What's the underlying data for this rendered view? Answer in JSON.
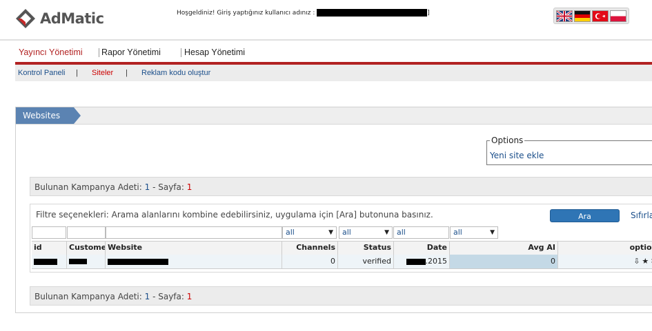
{
  "header": {
    "logo_text": "AdMatic",
    "welcome_text": "Hoşgeldiniz! Giriş yaptığınız kullanıcı adınız :",
    "welcome_suffix": "]",
    "flags": [
      "uk-flag-icon",
      "germany-flag-icon",
      "turkey-flag-icon",
      "poland-flag-icon"
    ]
  },
  "main_nav": {
    "items": [
      {
        "label": "Yayıncı Yönetimi",
        "active": true
      },
      {
        "label": "Rapor Yönetimi",
        "active": false
      },
      {
        "label": "Hesap Yönetimi",
        "active": false
      }
    ]
  },
  "sub_nav": {
    "items": [
      {
        "label": "Kontrol Paneli",
        "active": false
      },
      {
        "label": "Siteler",
        "active": true
      },
      {
        "label": "Reklam kodu oluştur",
        "active": false
      }
    ],
    "separator": "|"
  },
  "panel": {
    "tab_label": "Websites",
    "options": {
      "legend": "Options",
      "link": "Yeni site ekle"
    },
    "summary": {
      "prefix": "Bulunan Kampanya Adeti:",
      "count": "1",
      "page_prefix": "- Sayfa:",
      "page": "1"
    },
    "filter": {
      "text": "Filtre seçenekleri: Arama alanlarını kombine edebilirsiniz, uygulama için [Ara] butonuna basınız.",
      "search_button": "Ara",
      "reset_link": "Sıfırla",
      "selects": [
        "all",
        "all",
        "all"
      ],
      "date_input": "all"
    },
    "table": {
      "columns": [
        "id",
        "Customer",
        "Website",
        "Channels",
        "Status",
        "Date",
        "Avg AI",
        "options"
      ],
      "rows": [
        {
          "channels": "0",
          "status": "verified",
          "date_suffix": ".2015",
          "avg": "0"
        }
      ]
    }
  },
  "colors": {
    "accent_red": "#b22222",
    "link_blue": "#1a4e8a",
    "tab_blue": "#5b83b2",
    "button_blue": "#2f75b5"
  }
}
